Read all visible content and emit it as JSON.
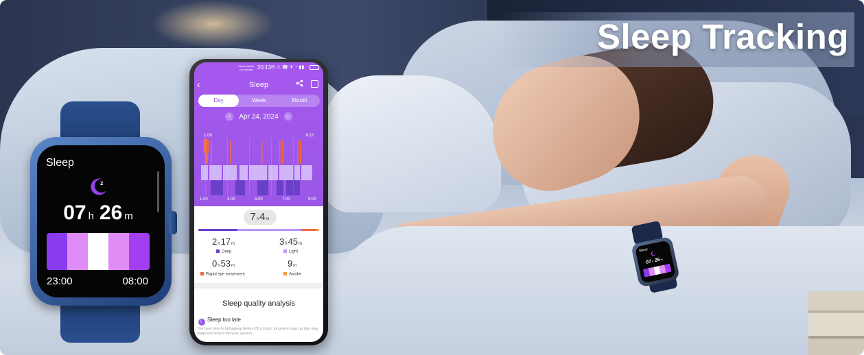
{
  "title": "Sleep Tracking",
  "colors": {
    "accent": "#9a57e6",
    "deep": "#6a3fc9",
    "light": "#b996f5",
    "rem": "#ef6a4a",
    "awake": "#f39b3d"
  },
  "watch": {
    "title": "Sleep",
    "moon_icon": "moon-sleep-icon",
    "hours": "07",
    "hours_unit": "h",
    "minutes": "26",
    "minutes_unit": "m",
    "start_time": "23:00",
    "end_time": "08:00",
    "bar_colors": [
      "#8a3bf0",
      "#e08cf6",
      "#ffffff",
      "#e08cf6",
      "#a33ff0"
    ]
  },
  "phone": {
    "status": {
      "carrier": "China Mobile\nNo service",
      "time": "20:13",
      "icons": "✉ ⚠ ☎ ✈ ◔ ▮▮"
    },
    "nav": {
      "back_icon": "back-chevron-icon",
      "title": "Sleep",
      "share_icon": "share-icon",
      "calendar_icon": "calendar-icon"
    },
    "tabs": [
      {
        "label": "Day",
        "active": true
      },
      {
        "label": "Week",
        "active": false
      },
      {
        "label": "Month",
        "active": false
      }
    ],
    "date": {
      "prev": "‹",
      "label": "Apr 24, 2024",
      "next": "›"
    },
    "chart": {
      "start_label": "1:08",
      "end_label": "8:12",
      "x_ticks": [
        "1:00",
        "3:00",
        "5:00",
        "7:00",
        "9:00"
      ]
    },
    "total": {
      "hours": "7",
      "hours_unit": "h",
      "minutes": "4",
      "minutes_unit": "m"
    },
    "stats": [
      {
        "hours": "2",
        "h_unit": "h",
        "minutes": "17",
        "m_unit": "m",
        "label": "Deep"
      },
      {
        "hours": "3",
        "h_unit": "h",
        "minutes": "45",
        "m_unit": "m",
        "label": "Light"
      },
      {
        "hours": "0",
        "h_unit": "h",
        "minutes": "53",
        "m_unit": "m",
        "label": "Rapid eye movement"
      },
      {
        "hours": "",
        "h_unit": "",
        "minutes": "9",
        "m_unit": "m",
        "label": "Awake"
      }
    ],
    "analysis": {
      "title": "Sleep quality analysis",
      "issue": "Sleep too late",
      "issue_icon": "moon-badge-icon",
      "description": "The best time to fall asleep before 22 o'clock, long-term stay up late may make the body's immune system..."
    }
  },
  "wrist_watch": {
    "title": "Sleep",
    "hours": "07",
    "h_unit": "h",
    "minutes": "26",
    "m_unit": "m"
  }
}
